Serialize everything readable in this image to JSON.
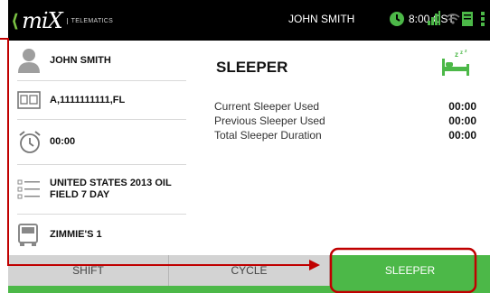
{
  "topbar": {
    "brand": "miX",
    "brand_sub": "TELEMATICS",
    "user": "JOHN SMITH",
    "time": "8:00 CST"
  },
  "left": {
    "driver": "JOHN SMITH",
    "license": "A,1111111111,FL",
    "timer": "00:00",
    "ruleset": [
      "UNITED STATES 2013 OIL",
      "FIELD 7 DAY"
    ],
    "vehicle": "ZIMMIE'S 1"
  },
  "main": {
    "title": "SLEEPER",
    "metrics": [
      {
        "label": "Current Sleeper Used",
        "value": "00:00"
      },
      {
        "label": "Previous Sleeper Used",
        "value": "00:00"
      },
      {
        "label": "Total Sleeper Duration",
        "value": "00:00"
      }
    ]
  },
  "tabs": [
    {
      "label": "SHIFT",
      "active": false
    },
    {
      "label": "CYCLE",
      "active": false
    },
    {
      "label": "SLEEPER",
      "active": true
    }
  ],
  "colors": {
    "accent": "#4cb848",
    "topbar": "#000000",
    "annotation": "#c00000"
  }
}
